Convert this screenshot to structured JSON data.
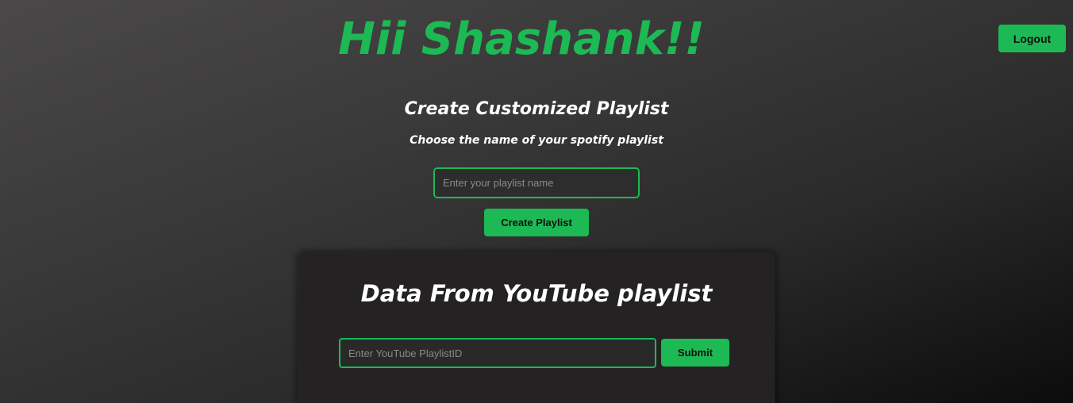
{
  "header": {
    "greeting": "Hii Shashank!!",
    "logout_label": "Logout"
  },
  "create_playlist": {
    "title": "Create Customized Playlist",
    "subtitle": "Choose the name of your spotify playlist",
    "input_placeholder": "Enter your playlist name",
    "input_value": "",
    "button_label": "Create Playlist"
  },
  "youtube": {
    "title": "Data From YouTube playlist",
    "input_placeholder": "Enter YouTube PlaylistID",
    "input_value": "",
    "submit_label": "Submit"
  },
  "colors": {
    "accent": "#1db954",
    "card_background": "#242222",
    "button_text": "#111111"
  }
}
